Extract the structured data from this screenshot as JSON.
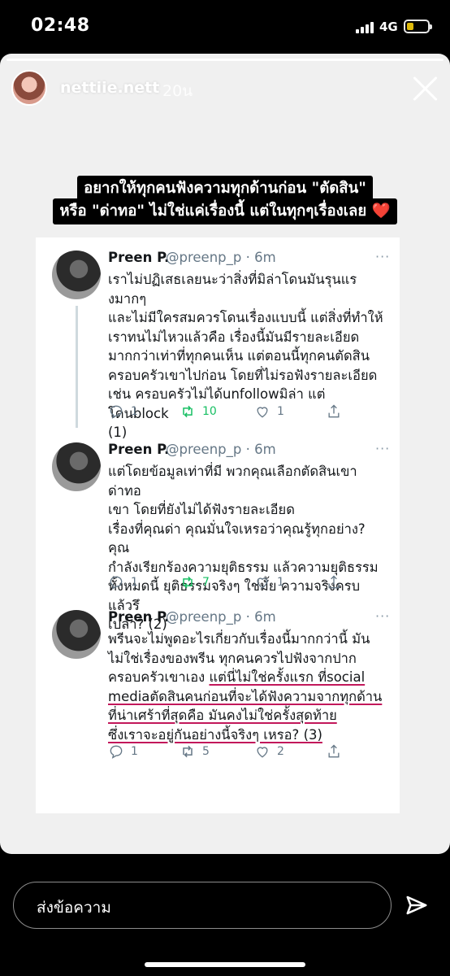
{
  "status": {
    "time": "02:48",
    "network": "4G"
  },
  "story": {
    "username": "nettiie.nett",
    "time_ago": "20น",
    "caption_line1": "อยากให้ทุกคนฟังความทุกด้านก่อน \"ตัดสิน\"",
    "caption_line2": "หรือ \"ด่าทอ\" ไม่ใช่แค่เรื่องนี้ แต่ในทุกๆเรื่องเลย ❤️"
  },
  "tweets": [
    {
      "name": "Preen P.",
      "handle": "@preenp_p · 6m",
      "more": "···",
      "lines": [
        "เราไม่ปฏิเสธเลยนะว่าสิ่งที่มิล่าโดนมันรุนแรงมากๆ",
        "และไม่มีใครสมควรโดนเรื่องแบบนี้ แต่สิ่งที่ทำให้",
        "เราทนไม่ไหวแล้วคือ เรื่องนี้มันมีรายละเอียด",
        "มากกว่าเท่าที่ทุกคนเห็น แต่ตอนนี้ทุกคนตัดสิน",
        "ครอบครัวเขาไปก่อน โดยที่ไม่รอฟังรายละเอียด",
        "เช่น ครอบครัวไม่ได้unfollowมิล่า แต่โดนblock",
        "(1)"
      ],
      "replies": "1",
      "retweets": "10",
      "likes": "1"
    },
    {
      "name": "Preen P.",
      "handle": "@preenp_p · 6m",
      "more": "···",
      "lines": [
        "แต่โดยข้อมูลเท่าที่มี พวกคุณเลือกตัดสินเขา ด่าทอ",
        "เขา โดยที่ยังไม่ได้ฟังรายละเอียด",
        "เรื่องที่คุณด่า คุณมั่นใจเหรอว่าคุณรู้ทุกอย่าง? คุณ",
        "กำลังเรียกร้องความยุติธรรม แล้วความยุติธรรม",
        "ทั้งหมดนี้ ยุติธรรมจริงๆ ใช่มั้ย ความจริงครบแล้วรึ",
        "เปล่า? (2)"
      ],
      "replies": "1",
      "retweets": "7",
      "likes": "1"
    },
    {
      "name": "Preen P.",
      "handle": "@preenp_p · 6m",
      "more": "···",
      "lines": [
        "พรีนจะไม่พูดอะไรเกี่ยวกับเรื่องนี้มากกว่านี้ มัน",
        "ไม่ใช่เรื่องของพรีน ทุกคนควรไปฟังจากปาก",
        "ครอบครัวเขาเอง ",
        "mediaตัดสินคนก่อนที่จะได้ฟังความจากทุกด้าน",
        "ที่น่าเศร้าที่สุดคือ มันคงไม่ใช่ครั้งสุดท้าย",
        "ซึ่งเราจะอยู่กันอย่างนี้จริงๆ เหรอ? (3)"
      ],
      "underlined_part": "แต่นี่ไม่ใช่ครั้งแรก ที่social",
      "replies": "1",
      "retweets": "5",
      "likes": "2"
    }
  ],
  "reply_bar": {
    "placeholder": "ส่งข้อความ"
  },
  "colors": {
    "retweet_active": "#17bf63",
    "underline": "#c2185b",
    "text": "#14171a",
    "muted": "#657786"
  }
}
